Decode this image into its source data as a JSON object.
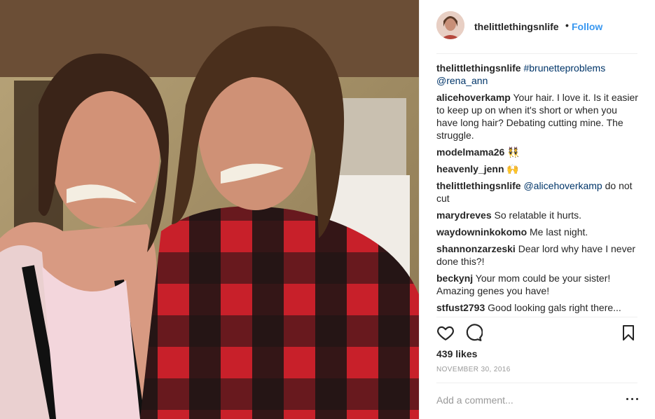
{
  "post": {
    "username": "thelittlethingsnlife",
    "dot": "•",
    "follow_label": "Follow",
    "caption": {
      "username": "thelittlethingsnlife",
      "hashtag": "#brunetteproblems",
      "mention": "@rena_ann"
    },
    "comments": [
      {
        "username": "alicehoverkamp",
        "text": "Your hair. I love it. Is it easier to keep up on when it's short or when you have long hair? Debating cutting mine. The struggle."
      },
      {
        "username": "modelmama26",
        "text": "👯"
      },
      {
        "username": "heavenly_jenn",
        "text": "🙌"
      },
      {
        "username": "thelittlethingsnlife",
        "mention": "@alicehoverkamp",
        "text": "do not cut"
      },
      {
        "username": "marydreves",
        "text": "So relatable it hurts."
      },
      {
        "username": "waydowninkokomo",
        "text": "Me last night."
      },
      {
        "username": "shannonzarzeski",
        "text": "Dear lord why have I never done this?!"
      },
      {
        "username": "beckynj",
        "text": "Your mom could be your sister! Amazing genes you have!"
      },
      {
        "username": "stfust2793",
        "text": "Good looking gals right there..."
      }
    ],
    "likes": "439 likes",
    "date": "NOVEMBER 30, 2016",
    "add_comment_placeholder": "Add a comment..."
  },
  "icons": {
    "like": "heart-icon",
    "comment": "speech-bubble-icon",
    "save": "bookmark-icon",
    "more": "more-options-icon"
  },
  "colors": {
    "link_blue": "#3897f0",
    "mention_blue": "#003569",
    "muted_gray": "#999999",
    "flannel_red": "#c8202a"
  }
}
